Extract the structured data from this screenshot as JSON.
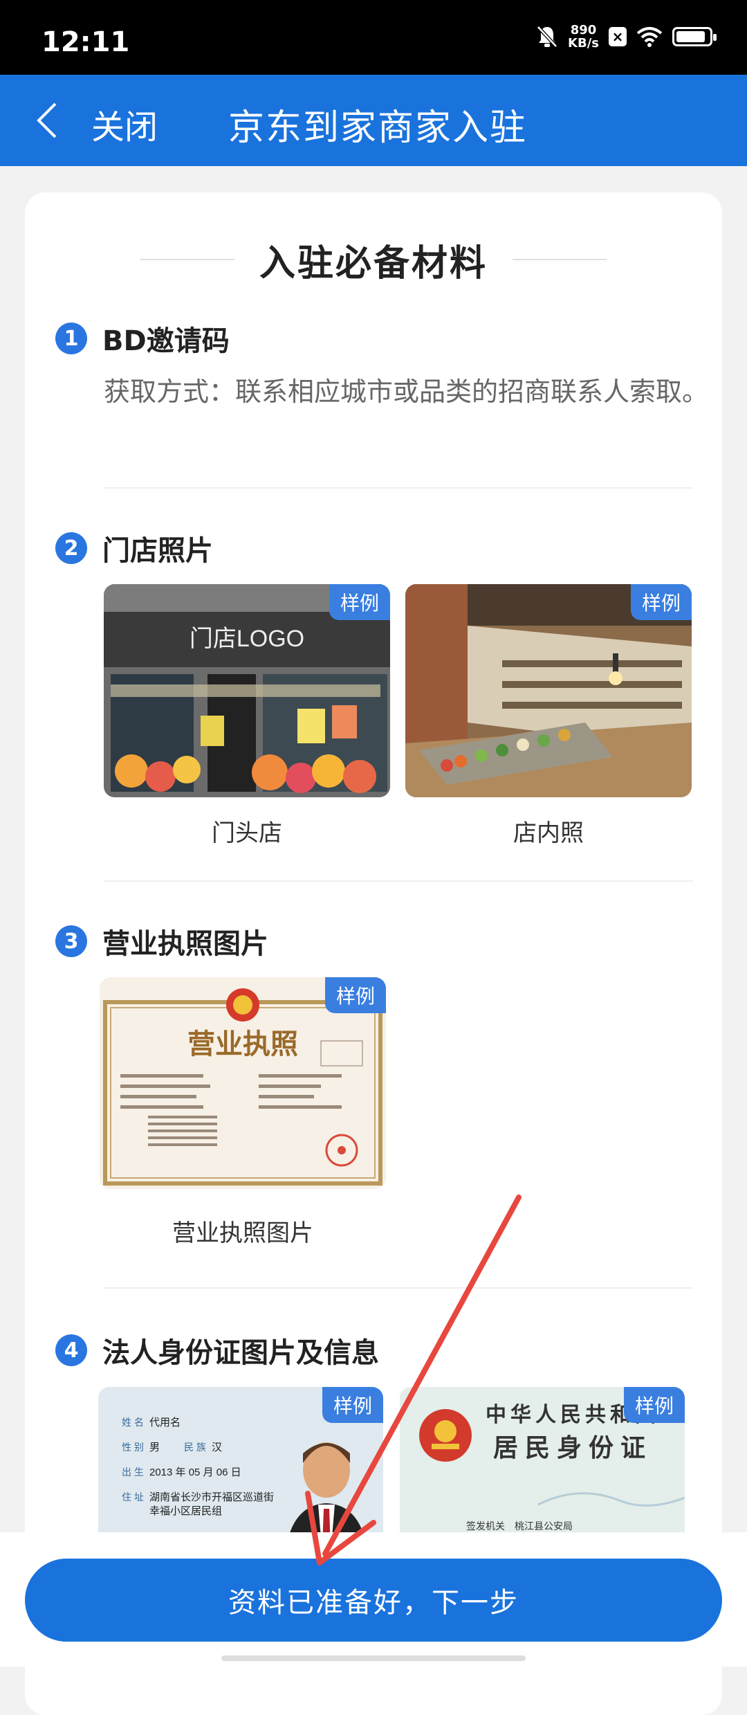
{
  "status_bar": {
    "time": "12:11",
    "net_speed_value": "890",
    "net_speed_unit": "KB/s",
    "battery_level": 0.9
  },
  "nav": {
    "back_icon": "chevron-left-icon",
    "close_label": "关闭",
    "title": "京东到家商家入驻"
  },
  "section_title": "入驻必备材料",
  "steps": [
    {
      "num": "1",
      "title": "BD邀请码",
      "desc": "获取方式：联系相应城市或品类的招商联系人索取。"
    },
    {
      "num": "2",
      "title": "门店照片"
    },
    {
      "num": "3",
      "title": "营业执照图片"
    },
    {
      "num": "4",
      "title": "法人身份证图片及信息"
    }
  ],
  "sample_tag": "样例",
  "photos": {
    "storefront": {
      "sign": "门店LOGO",
      "caption": "门头店"
    },
    "interior": {
      "caption": "店内照"
    },
    "license": {
      "heading": "营业执照",
      "caption": "营业执照图片"
    },
    "id_front": {
      "name_label": "姓 名",
      "name": "代用名",
      "gender_label": "性 别",
      "gender": "男",
      "ethnic_label": "民 族",
      "ethnic": "汉",
      "birth_label": "出 生",
      "birth": "2013 年 05 月 06 日",
      "addr_label": "住 址",
      "addr1": "湖南省长沙市开福区巡道街",
      "addr2": "幸福小区居民组"
    },
    "id_back": {
      "line1": "中华人民共和国",
      "line2": "居民身份证",
      "authority_label": "签发机关",
      "authority": "桃江县公安局"
    }
  },
  "next_button": "资料已准备好，下一步",
  "colors": {
    "primary": "#1a73dc",
    "arrow": "#e8473f"
  }
}
